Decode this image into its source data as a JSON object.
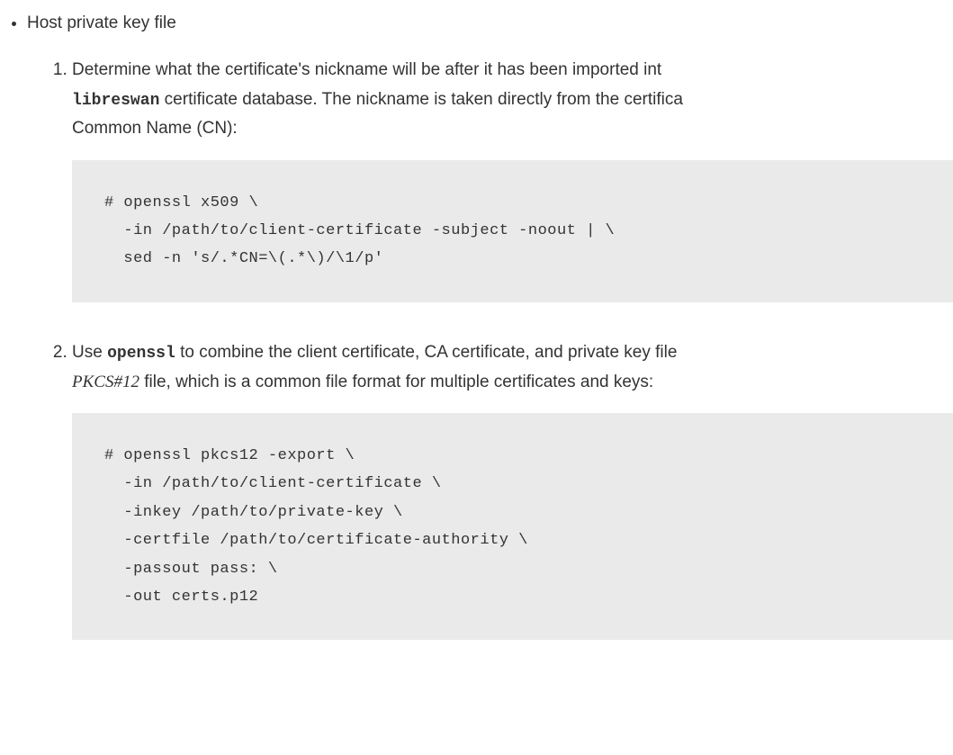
{
  "bullet": {
    "title": "Host private key file"
  },
  "steps": [
    {
      "text_1": "Determine what the certificate's nickname will be after it has been imported int",
      "code_1": "libreswan",
      "text_2": " certificate database. The nickname is taken directly from the certifica",
      "text_3": "Common Name (CN):",
      "code_block": "# openssl x509 \\\n  -in /path/to/client-certificate -subject -noout | \\\n  sed -n 's/.*CN=\\(.*\\)/\\1/p'"
    },
    {
      "text_1": "Use ",
      "code_1": "openssl",
      "text_2": " to combine the client certificate, CA certificate, and private key file",
      "italic_1": "PKCS#12",
      "text_3": " file, which is a common file format for multiple certificates and keys:",
      "code_block": "# openssl pkcs12 -export \\\n  -in /path/to/client-certificate \\\n  -inkey /path/to/private-key \\\n  -certfile /path/to/certificate-authority \\\n  -passout pass: \\\n  -out certs.p12"
    }
  ]
}
